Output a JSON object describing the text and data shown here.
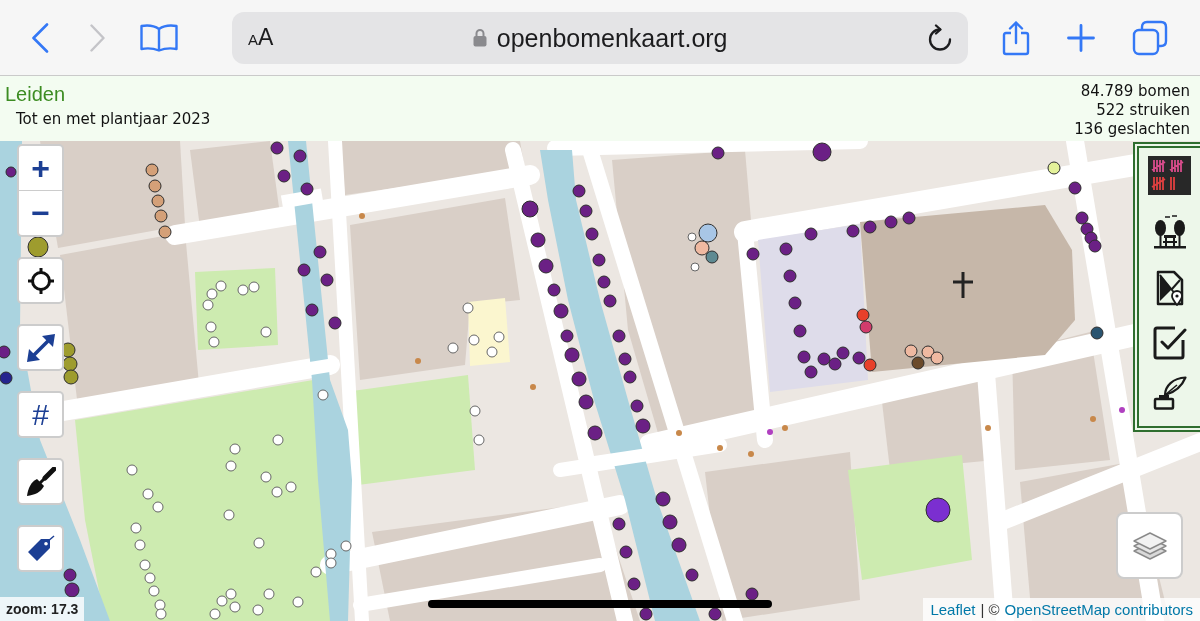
{
  "browser": {
    "back": {
      "disabled": false
    },
    "forward": {
      "disabled": true
    },
    "address_bar": {
      "text_size_label": "AA",
      "url": "openbomenkaart.org",
      "secure": true
    }
  },
  "info_bar": {
    "city": "Leiden",
    "subtitle": "Tot en met plantjaar 2023",
    "stats": [
      "84.789 bomen",
      "522 struiken",
      "136 geslachten"
    ]
  },
  "map": {
    "zoom_in_label": "+",
    "zoom_out_label": "−",
    "grid_button_label": "#",
    "zoom_label": "zoom: 17.3",
    "attribution": [
      {
        "kind": "link",
        "text": "Leaflet"
      },
      {
        "kind": "text",
        "text": "| ©"
      },
      {
        "kind": "link",
        "text": "OpenStreetMap contributors"
      }
    ],
    "tree_markers": [
      {
        "color": "#d4a078"
      },
      {
        "color": "#d4a078"
      },
      {
        "color": "#d4a078"
      },
      {
        "color": "#d4a078"
      },
      {
        "color": "#d4a078"
      },
      {
        "color": "#6b2085"
      },
      {
        "color": "#6b2085"
      },
      {
        "color": "#6b2085"
      },
      {
        "color": "#6b2085"
      },
      {
        "color": "#6b2085"
      },
      {
        "color": "#6b2085"
      },
      {
        "color": "#6b2085"
      },
      {
        "color": "#6b2085"
      },
      {
        "color": "#6b2085"
      },
      {
        "color": "#6b2085"
      },
      {
        "color": "#9e9c2e"
      },
      {
        "color": "#9e9c2e"
      },
      {
        "color": "#9e9c2e"
      },
      {
        "color": "#9e9c2e"
      },
      {
        "color": "#6b2085"
      },
      {
        "color": "#25248e"
      },
      {
        "color": "#6b2085"
      },
      {
        "color": "#6b2085"
      },
      {
        "color": "#6b2085"
      },
      {
        "color": "#6b2085"
      },
      {
        "color": "#6b2085"
      },
      {
        "color": "#6b2085"
      },
      {
        "color": "#6b2085"
      },
      {
        "color": "#6b2085"
      },
      {
        "color": "#6b2085"
      },
      {
        "color": "#6b2085"
      },
      {
        "color": "#6b2085"
      },
      {
        "color": "#6b2085"
      },
      {
        "color": "#6b2085"
      },
      {
        "color": "#6b2085"
      },
      {
        "color": "#6b2085"
      },
      {
        "color": "#6b2085"
      },
      {
        "color": "#6b2085"
      },
      {
        "color": "#6b2085"
      },
      {
        "color": "#6b2085"
      },
      {
        "color": "#6b2085"
      },
      {
        "color": "#6b2085"
      },
      {
        "color": "#6b2085"
      },
      {
        "color": "#6b2085"
      },
      {
        "color": "#6b2085"
      },
      {
        "color": "#6b2085"
      },
      {
        "color": "#6b2085"
      },
      {
        "color": "#6b2085"
      },
      {
        "color": "#6b2085"
      },
      {
        "color": "#6b2085"
      },
      {
        "color": "#6b2085"
      },
      {
        "color": "#6b2085"
      },
      {
        "color": "#6b2085"
      },
      {
        "color": "#6b2085"
      },
      {
        "color": "#6b2085"
      },
      {
        "color": "#6b2085"
      },
      {
        "color": "#6b2085"
      },
      {
        "color": "#6b2085"
      },
      {
        "color": "#6b2085"
      },
      {
        "color": "#6b2085"
      },
      {
        "color": "#6b2085"
      },
      {
        "color": "#6b2085"
      },
      {
        "color": "#6b2085"
      },
      {
        "color": "#6b2085"
      },
      {
        "color": "#6b2085"
      },
      {
        "color": "#6b2085"
      },
      {
        "color": "#6b2085"
      },
      {
        "color": "#6b2085"
      },
      {
        "color": "#6b2085"
      },
      {
        "color": "#6b2085"
      },
      {
        "color": "#6b2085"
      },
      {
        "color": "#6b2085"
      },
      {
        "color": "#e8402a"
      },
      {
        "color": "#d23c6c"
      },
      {
        "color": "#a8c6e6"
      },
      {
        "color": "#efb9a1"
      },
      {
        "color": "#5e8a92"
      },
      {
        "color": "#ffffff"
      },
      {
        "color": "#ffffff"
      },
      {
        "color": "#e8402a"
      },
      {
        "color": "#efb9a1"
      },
      {
        "color": "#6b4a2a"
      },
      {
        "color": "#efb9a1"
      },
      {
        "color": "#efb9a1"
      },
      {
        "color": "#e4f29a"
      },
      {
        "color": "#6b2085"
      },
      {
        "color": "#6b2085"
      },
      {
        "color": "#6b2085"
      },
      {
        "color": "#6b2085"
      },
      {
        "color": "#6b2085"
      },
      {
        "color": "#2a5470"
      },
      {
        "color": "#7b2fd0"
      },
      {
        "color": "#ffffff"
      },
      {
        "color": "#ffffff"
      },
      {
        "color": "#ffffff"
      },
      {
        "color": "#ffffff"
      },
      {
        "color": "#ffffff"
      },
      {
        "color": "#ffffff"
      },
      {
        "color": "#ffffff"
      },
      {
        "color": "#ffffff"
      },
      {
        "color": "#ffffff"
      },
      {
        "color": "#ffffff"
      },
      {
        "color": "#ffffff"
      },
      {
        "color": "#ffffff"
      },
      {
        "color": "#ffffff"
      },
      {
        "color": "#ffffff"
      },
      {
        "color": "#ffffff"
      },
      {
        "color": "#ffffff"
      },
      {
        "color": "#ffffff"
      },
      {
        "color": "#ffffff"
      },
      {
        "color": "#ffffff"
      },
      {
        "color": "#ffffff"
      },
      {
        "color": "#ffffff"
      },
      {
        "color": "#ffffff"
      },
      {
        "color": "#ffffff"
      },
      {
        "color": "#ffffff"
      },
      {
        "color": "#ffffff"
      },
      {
        "color": "#ffffff"
      },
      {
        "color": "#ffffff"
      },
      {
        "color": "#ffffff"
      },
      {
        "color": "#ffffff"
      },
      {
        "color": "#ffffff"
      },
      {
        "color": "#ffffff"
      },
      {
        "color": "#ffffff"
      },
      {
        "color": "#ffffff"
      },
      {
        "color": "#ffffff"
      },
      {
        "color": "#ffffff"
      },
      {
        "color": "#ffffff"
      },
      {
        "color": "#ffffff"
      },
      {
        "color": "#ffffff"
      },
      {
        "color": "#ffffff"
      },
      {
        "color": "#ffffff"
      },
      {
        "color": "#ffffff"
      },
      {
        "color": "#ffffff"
      },
      {
        "color": "#ffffff"
      },
      {
        "color": "#ffffff"
      },
      {
        "color": "#ffffff"
      }
    ]
  }
}
